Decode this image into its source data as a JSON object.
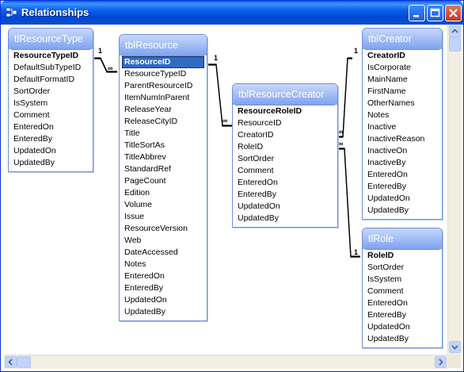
{
  "window": {
    "title": "Relationships"
  },
  "tables": [
    {
      "id": "tlResourceType",
      "name": "tlResourceType",
      "fields": [
        "ResourceTypeID",
        "DefaultSubTypeID",
        "DefaultFormatID",
        "SortOrder",
        "IsSystem",
        "Comment",
        "EnteredOn",
        "EnteredBy",
        "UpdatedOn",
        "UpdatedBy"
      ]
    },
    {
      "id": "tblResource",
      "name": "tblResource",
      "fields": [
        "ResourceID",
        "ResourceTypeID",
        "ParentResourceID",
        "ItemNumInParent",
        "ReleaseYear",
        "ReleaseCityID",
        "Title",
        "TitleSortAs",
        "TitleAbbrev",
        "StandardRef",
        "PageCount",
        "Edition",
        "Volume",
        "Issue",
        "ResourceVersion",
        "Web",
        "DateAccessed",
        "Notes",
        "EnteredOn",
        "EnteredBy",
        "UpdatedOn",
        "UpdatedBy"
      ]
    },
    {
      "id": "tblResourceCreator",
      "name": "tblResourceCreator",
      "fields": [
        "ResourceRoleID",
        "ResourceID",
        "CreatorID",
        "RoleID",
        "SortOrder",
        "Comment",
        "EnteredOn",
        "EnteredBy",
        "UpdatedOn",
        "UpdatedBy"
      ]
    },
    {
      "id": "tblCreator",
      "name": "tblCreator",
      "fields": [
        "CreatorID",
        "IsCorporate",
        "MainName",
        "FirstName",
        "OtherNames",
        "Notes",
        "Inactive",
        "InactiveReason",
        "InactiveOn",
        "InactiveBy",
        "EnteredOn",
        "EnteredBy",
        "UpdatedOn",
        "UpdatedBy"
      ]
    },
    {
      "id": "tlRole",
      "name": "tlRole",
      "fields": [
        "RoleID",
        "SortOrder",
        "IsSystem",
        "Comment",
        "EnteredOn",
        "EnteredBy",
        "UpdatedOn",
        "UpdatedBy"
      ]
    }
  ],
  "cardinality": {
    "one": "1",
    "many": "∞"
  },
  "colors": {
    "title_bar": "#0a5fe8",
    "table_header": "#7ea3f0",
    "selection": "#316ac5"
  }
}
